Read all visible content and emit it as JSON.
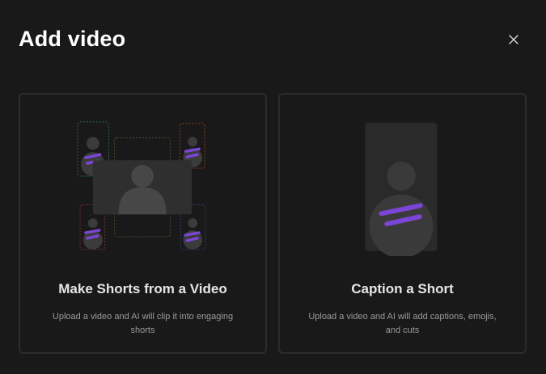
{
  "dialog": {
    "title": "Add video",
    "close_icon": "close-icon"
  },
  "options": [
    {
      "title": "Make Shorts from a Video",
      "description": "Upload a video and AI will clip it into engaging shorts",
      "illustration": "clips-collage-illustration"
    },
    {
      "title": "Caption a Short",
      "description": "Upload a video and AI will add captions, emojis, and cuts",
      "illustration": "captioned-short-illustration"
    }
  ],
  "colors": {
    "background": "#191919",
    "card_border": "#2c2c2c",
    "accent_purple": "#7b45d6",
    "placeholder_gray": "#3a3a3a"
  }
}
